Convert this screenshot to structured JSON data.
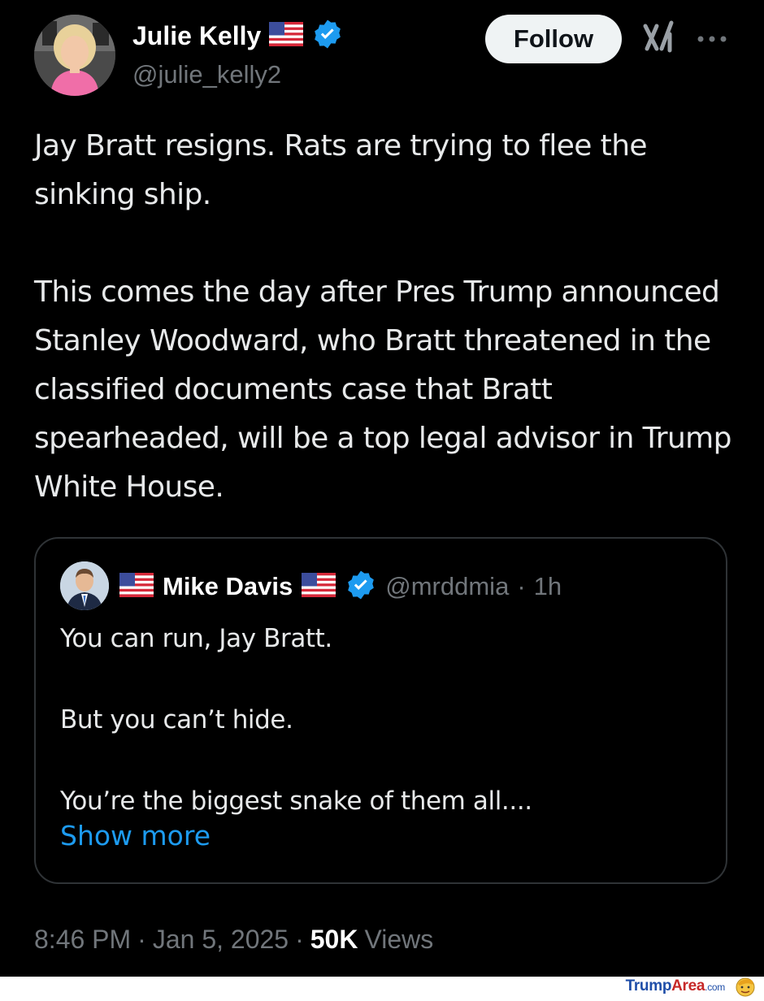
{
  "author": {
    "name": "Julie Kelly",
    "handle": "@julie_kelly2",
    "avatar_icon": "julie-kelly-avatar",
    "flag_icon": "us-flag-icon",
    "verified_icon": "verified-badge-icon"
  },
  "header": {
    "follow_label": "Follow",
    "grok_icon": "grok-icon",
    "more_icon": "more-options-icon"
  },
  "tweet": {
    "paragraph1": "Jay Bratt resigns. Rats are trying to flee the sinking ship.",
    "paragraph2": "This comes the day after Pres Trump announced Stanley Woodward, who Bratt threatened in the classified documents case that Bratt spearheaded, will be a top legal advisor in Trump White House."
  },
  "quote": {
    "name": "Mike Davis",
    "handle": "@mrddmia",
    "separator": "·",
    "time": "1h",
    "avatar_icon": "mike-davis-avatar",
    "lines": [
      "You can run, Jay Bratt.",
      "But you can’t hide.",
      "You’re the biggest snake of them all...."
    ],
    "show_more": "Show more"
  },
  "meta": {
    "time": "8:46 PM",
    "sep1": "·",
    "date": "Jan 5, 2025",
    "sep2": "·",
    "views_count": "50K",
    "views_label": "Views"
  },
  "watermark": {
    "brand_a": "Trump",
    "brand_b": "Area",
    "brand_c": ".com",
    "icon": "trump-face-icon"
  },
  "colors": {
    "background": "#000000",
    "text": "#e7e9ea",
    "muted": "#71767b",
    "link": "#1d9bf0",
    "verified": "#1d9bf0",
    "follow_bg": "#eff3f4",
    "quote_border": "#2f3336"
  }
}
